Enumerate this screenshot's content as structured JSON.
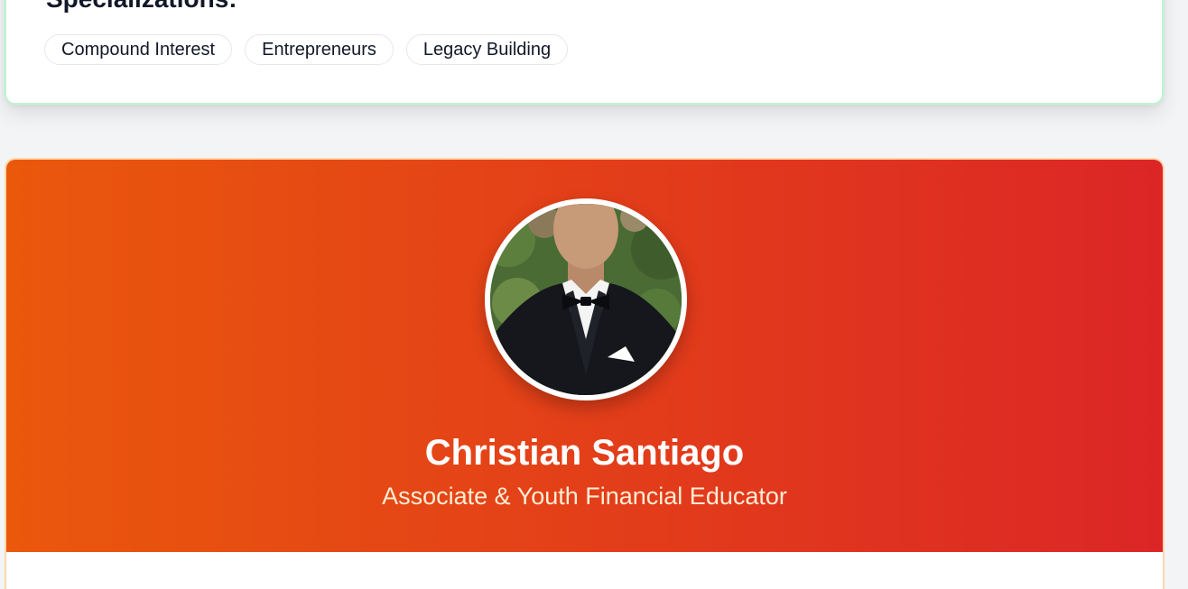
{
  "specializations": {
    "heading": "Specializations:",
    "tags": [
      "Compound Interest",
      "Entrepreneurs",
      "Legacy Building"
    ]
  },
  "profile": {
    "name": "Christian Santiago",
    "role": "Associate & Youth Financial Educator",
    "colors": {
      "gradient_start": "#ea580c",
      "gradient_end": "#dc2626"
    }
  }
}
